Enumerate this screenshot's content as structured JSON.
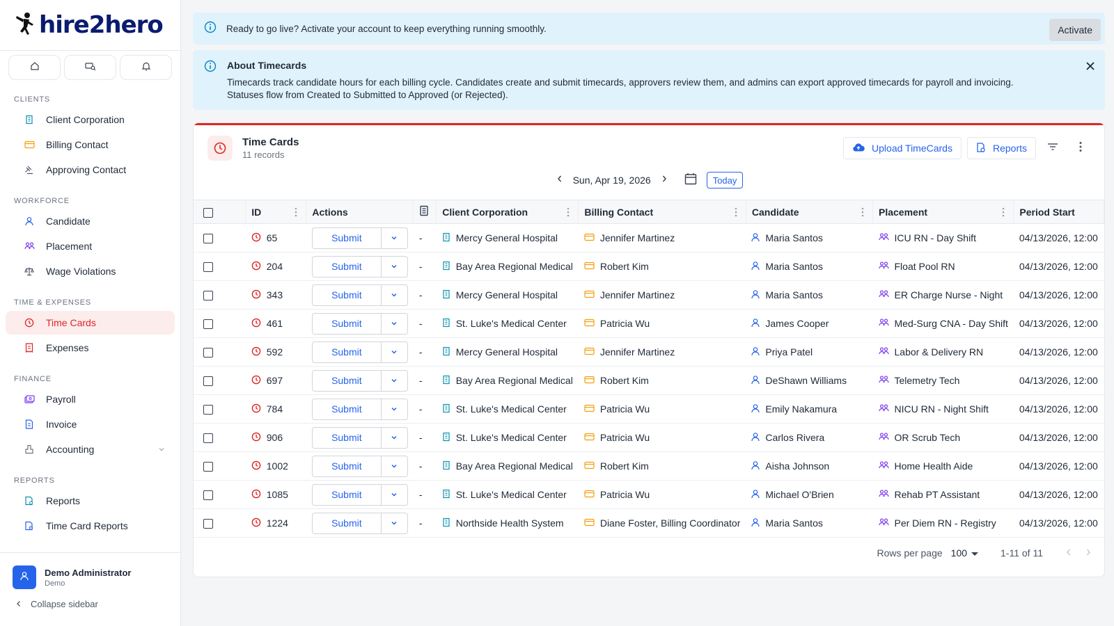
{
  "brand": {
    "logo_text_a": "hire",
    "logo_text_b": "2",
    "logo_text_c": "hero"
  },
  "sidebar": {
    "sections": [
      {
        "label": "CLIENTS",
        "items": [
          {
            "label": "Client Corporation",
            "icon": "building-icon"
          },
          {
            "label": "Billing Contact",
            "icon": "credit-card-icon"
          },
          {
            "label": "Approving Contact",
            "icon": "gavel-icon"
          }
        ]
      },
      {
        "label": "WORKFORCE",
        "items": [
          {
            "label": "Candidate",
            "icon": "user-icon"
          },
          {
            "label": "Placement",
            "icon": "users-icon"
          },
          {
            "label": "Wage Violations",
            "icon": "scale-icon"
          }
        ]
      },
      {
        "label": "TIME & EXPENSES",
        "items": [
          {
            "label": "Time Cards",
            "icon": "clock-icon",
            "active": true
          },
          {
            "label": "Expenses",
            "icon": "receipt-icon"
          }
        ]
      },
      {
        "label": "FINANCE",
        "items": [
          {
            "label": "Payroll",
            "icon": "payroll-icon"
          },
          {
            "label": "Invoice",
            "icon": "invoice-icon"
          },
          {
            "label": "Accounting",
            "icon": "accounting-icon",
            "expandable": true
          }
        ]
      },
      {
        "label": "REPORTS",
        "items": [
          {
            "label": "Reports",
            "icon": "report-icon"
          },
          {
            "label": "Time Card Reports",
            "icon": "timecard-report-icon"
          }
        ]
      }
    ],
    "user": {
      "name": "Demo Administrator",
      "role": "Demo"
    },
    "collapse_label": "Collapse sidebar"
  },
  "banner_activate": {
    "text": "Ready to go live? Activate your account to keep everything running smoothly.",
    "button": "Activate"
  },
  "banner_about": {
    "title": "About Timecards",
    "body": "Timecards track candidate hours for each billing cycle. Candidates create and submit timecards, approvers review them, and admins can export approved timecards for payroll and invoicing. Statuses flow from Created to Submitted to Approved (or Rejected)."
  },
  "card": {
    "title": "Time Cards",
    "subtitle": "11 records",
    "upload_label": "Upload TimeCards",
    "reports_label": "Reports",
    "date_label": "Sun, Apr 19, 2026",
    "today_label": "Today"
  },
  "table": {
    "columns": [
      "ID",
      "Actions",
      "Client Corporation",
      "Billing Contact",
      "Candidate",
      "Placement",
      "Period Start"
    ],
    "submit_label": "Submit",
    "rows": [
      {
        "id": "65",
        "dash": "-",
        "client": "Mercy General Hospital",
        "billing": "Jennifer Martinez",
        "candidate": "Maria Santos",
        "placement": "ICU RN - Day Shift",
        "period": "04/13/2026, 12:00"
      },
      {
        "id": "204",
        "dash": "-",
        "client": "Bay Area Regional Medical",
        "billing": "Robert Kim",
        "candidate": "Maria Santos",
        "placement": "Float Pool RN",
        "period": "04/13/2026, 12:00"
      },
      {
        "id": "343",
        "dash": "-",
        "client": "Mercy General Hospital",
        "billing": "Jennifer Martinez",
        "candidate": "Maria Santos",
        "placement": "ER Charge Nurse - Night",
        "period": "04/13/2026, 12:00"
      },
      {
        "id": "461",
        "dash": "-",
        "client": "St. Luke's Medical Center",
        "billing": "Patricia Wu",
        "candidate": "James Cooper",
        "placement": "Med-Surg CNA - Day Shift",
        "period": "04/13/2026, 12:00"
      },
      {
        "id": "592",
        "dash": "-",
        "client": "Mercy General Hospital",
        "billing": "Jennifer Martinez",
        "candidate": "Priya Patel",
        "placement": "Labor & Delivery RN",
        "period": "04/13/2026, 12:00"
      },
      {
        "id": "697",
        "dash": "-",
        "client": "Bay Area Regional Medical",
        "billing": "Robert Kim",
        "candidate": "DeShawn Williams",
        "placement": "Telemetry Tech",
        "period": "04/13/2026, 12:00"
      },
      {
        "id": "784",
        "dash": "-",
        "client": "St. Luke's Medical Center",
        "billing": "Patricia Wu",
        "candidate": "Emily Nakamura",
        "placement": "NICU RN - Night Shift",
        "period": "04/13/2026, 12:00"
      },
      {
        "id": "906",
        "dash": "-",
        "client": "St. Luke's Medical Center",
        "billing": "Patricia Wu",
        "candidate": "Carlos Rivera",
        "placement": "OR Scrub Tech",
        "period": "04/13/2026, 12:00"
      },
      {
        "id": "1002",
        "dash": "-",
        "client": "Bay Area Regional Medical",
        "billing": "Robert Kim",
        "candidate": "Aisha Johnson",
        "placement": "Home Health Aide",
        "period": "04/13/2026, 12:00"
      },
      {
        "id": "1085",
        "dash": "-",
        "client": "St. Luke's Medical Center",
        "billing": "Patricia Wu",
        "candidate": "Michael O'Brien",
        "placement": "Rehab PT Assistant",
        "period": "04/13/2026, 12:00"
      },
      {
        "id": "1224",
        "dash": "-",
        "client": "Northside Health System",
        "billing": "Diane Foster, Billing Coordinator",
        "candidate": "Maria Santos",
        "placement": "Per Diem RN - Registry",
        "period": "04/13/2026, 12:00"
      }
    ],
    "rows_per_page_label": "Rows per page",
    "rows_per_page_value": "100",
    "range_label": "1-11 of 11"
  },
  "colors": {
    "accent": "#dc2626",
    "link": "#2563eb",
    "banner": "#e0f2fb",
    "placement_icon": "#7c3aed",
    "billing_icon": "#f59e0b",
    "client_icon": "#0891b2"
  }
}
